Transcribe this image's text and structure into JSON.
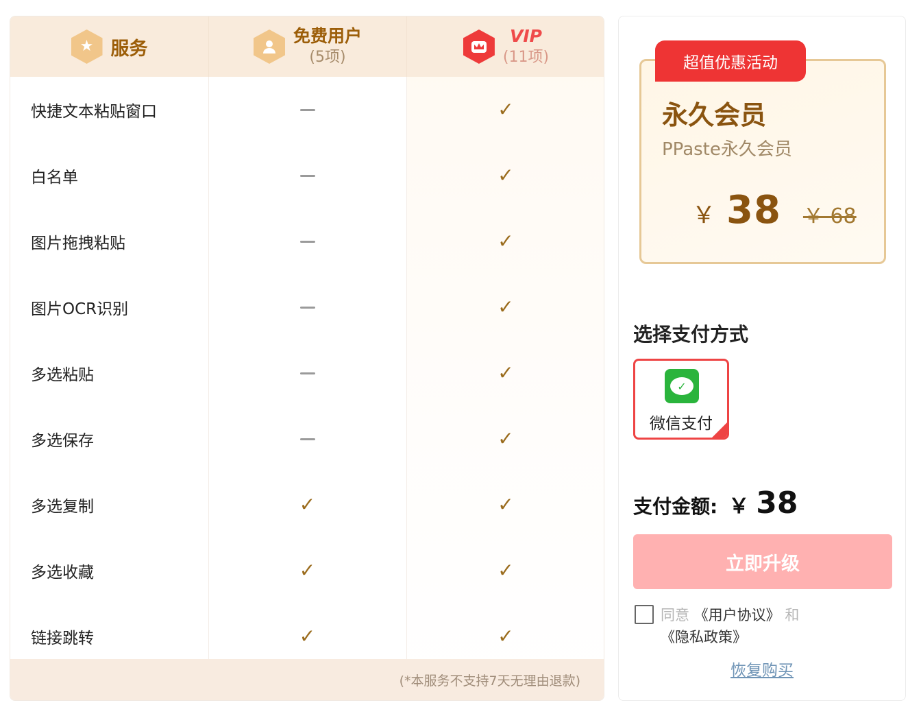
{
  "header": {
    "service_label": "服务",
    "free_label": "免费用户",
    "free_count": "(5项)",
    "vip_label": "VIP",
    "vip_count": "(11项)"
  },
  "icons": {
    "service": "star-icon",
    "free": "user-icon",
    "vip": "crown-icon",
    "included": "check-icon",
    "not_included": "dash-icon",
    "wechat": "wechat-pay-icon"
  },
  "features": [
    {
      "name": "快捷文本粘贴窗口",
      "free": false,
      "vip": true
    },
    {
      "name": "白名单",
      "free": false,
      "vip": true
    },
    {
      "name": "图片拖拽粘贴",
      "free": false,
      "vip": true
    },
    {
      "name": "图片OCR识别",
      "free": false,
      "vip": true
    },
    {
      "name": "多选粘贴",
      "free": false,
      "vip": true
    },
    {
      "name": "多选保存",
      "free": false,
      "vip": true
    },
    {
      "name": "多选复制",
      "free": true,
      "vip": true
    },
    {
      "name": "多选收藏",
      "free": true,
      "vip": true
    },
    {
      "name": "链接跳转",
      "free": true,
      "vip": true
    }
  ],
  "symbols": {
    "check": "✓"
  },
  "footnote": "(*本服务不支持7天无理由退款)",
  "promo": {
    "badge": "超值优惠活动",
    "title": "永久会员",
    "subtitle": "PPaste永久会员",
    "currency": "￥",
    "price": "38",
    "original_price": "￥ 68"
  },
  "payment": {
    "title": "选择支付方式",
    "method_label": "微信支付",
    "amount_label": "支付金额:",
    "currency": "￥",
    "amount": "38"
  },
  "actions": {
    "upgrade": "立即升级",
    "restore": "恢复购买"
  },
  "agreement": {
    "agree": "同意",
    "user_agreement": "《用户协议》",
    "and": "和",
    "privacy_policy": "《隐私政策》",
    "checked": false
  },
  "colors": {
    "header_bg": "#f9ebdc",
    "brand_gold": "#9c5e09",
    "accent_red": "#ee3434",
    "upgrade_button": "#ffb1b1",
    "wechat_green": "#2ab43c",
    "link_blue": "#6f94b6"
  }
}
